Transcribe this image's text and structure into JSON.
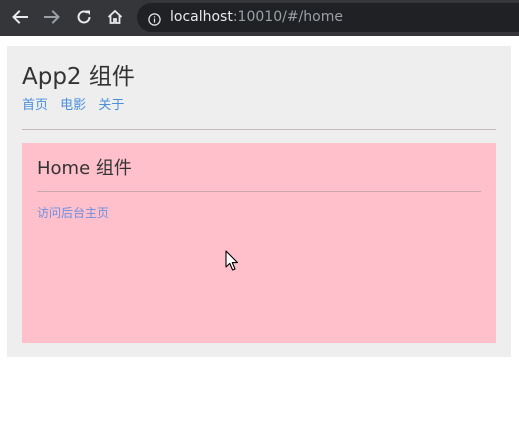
{
  "browser": {
    "url_host": "localhost",
    "url_rest": ":10010/#/home",
    "icons": [
      "back-arrow-icon",
      "forward-arrow-icon",
      "reload-icon",
      "home-icon",
      "info-icon"
    ]
  },
  "app": {
    "title": "App2 组件",
    "nav": {
      "home": "首页",
      "movie": "电影",
      "about": "关于"
    }
  },
  "home": {
    "title": "Home 组件",
    "link": "访问后台主页"
  },
  "colors": {
    "browser_bar": "#35363a",
    "omnibox": "#202124",
    "card_bg": "#eeeeee",
    "panel_bg": "#ffc0cb",
    "link": "#4a90d9"
  }
}
